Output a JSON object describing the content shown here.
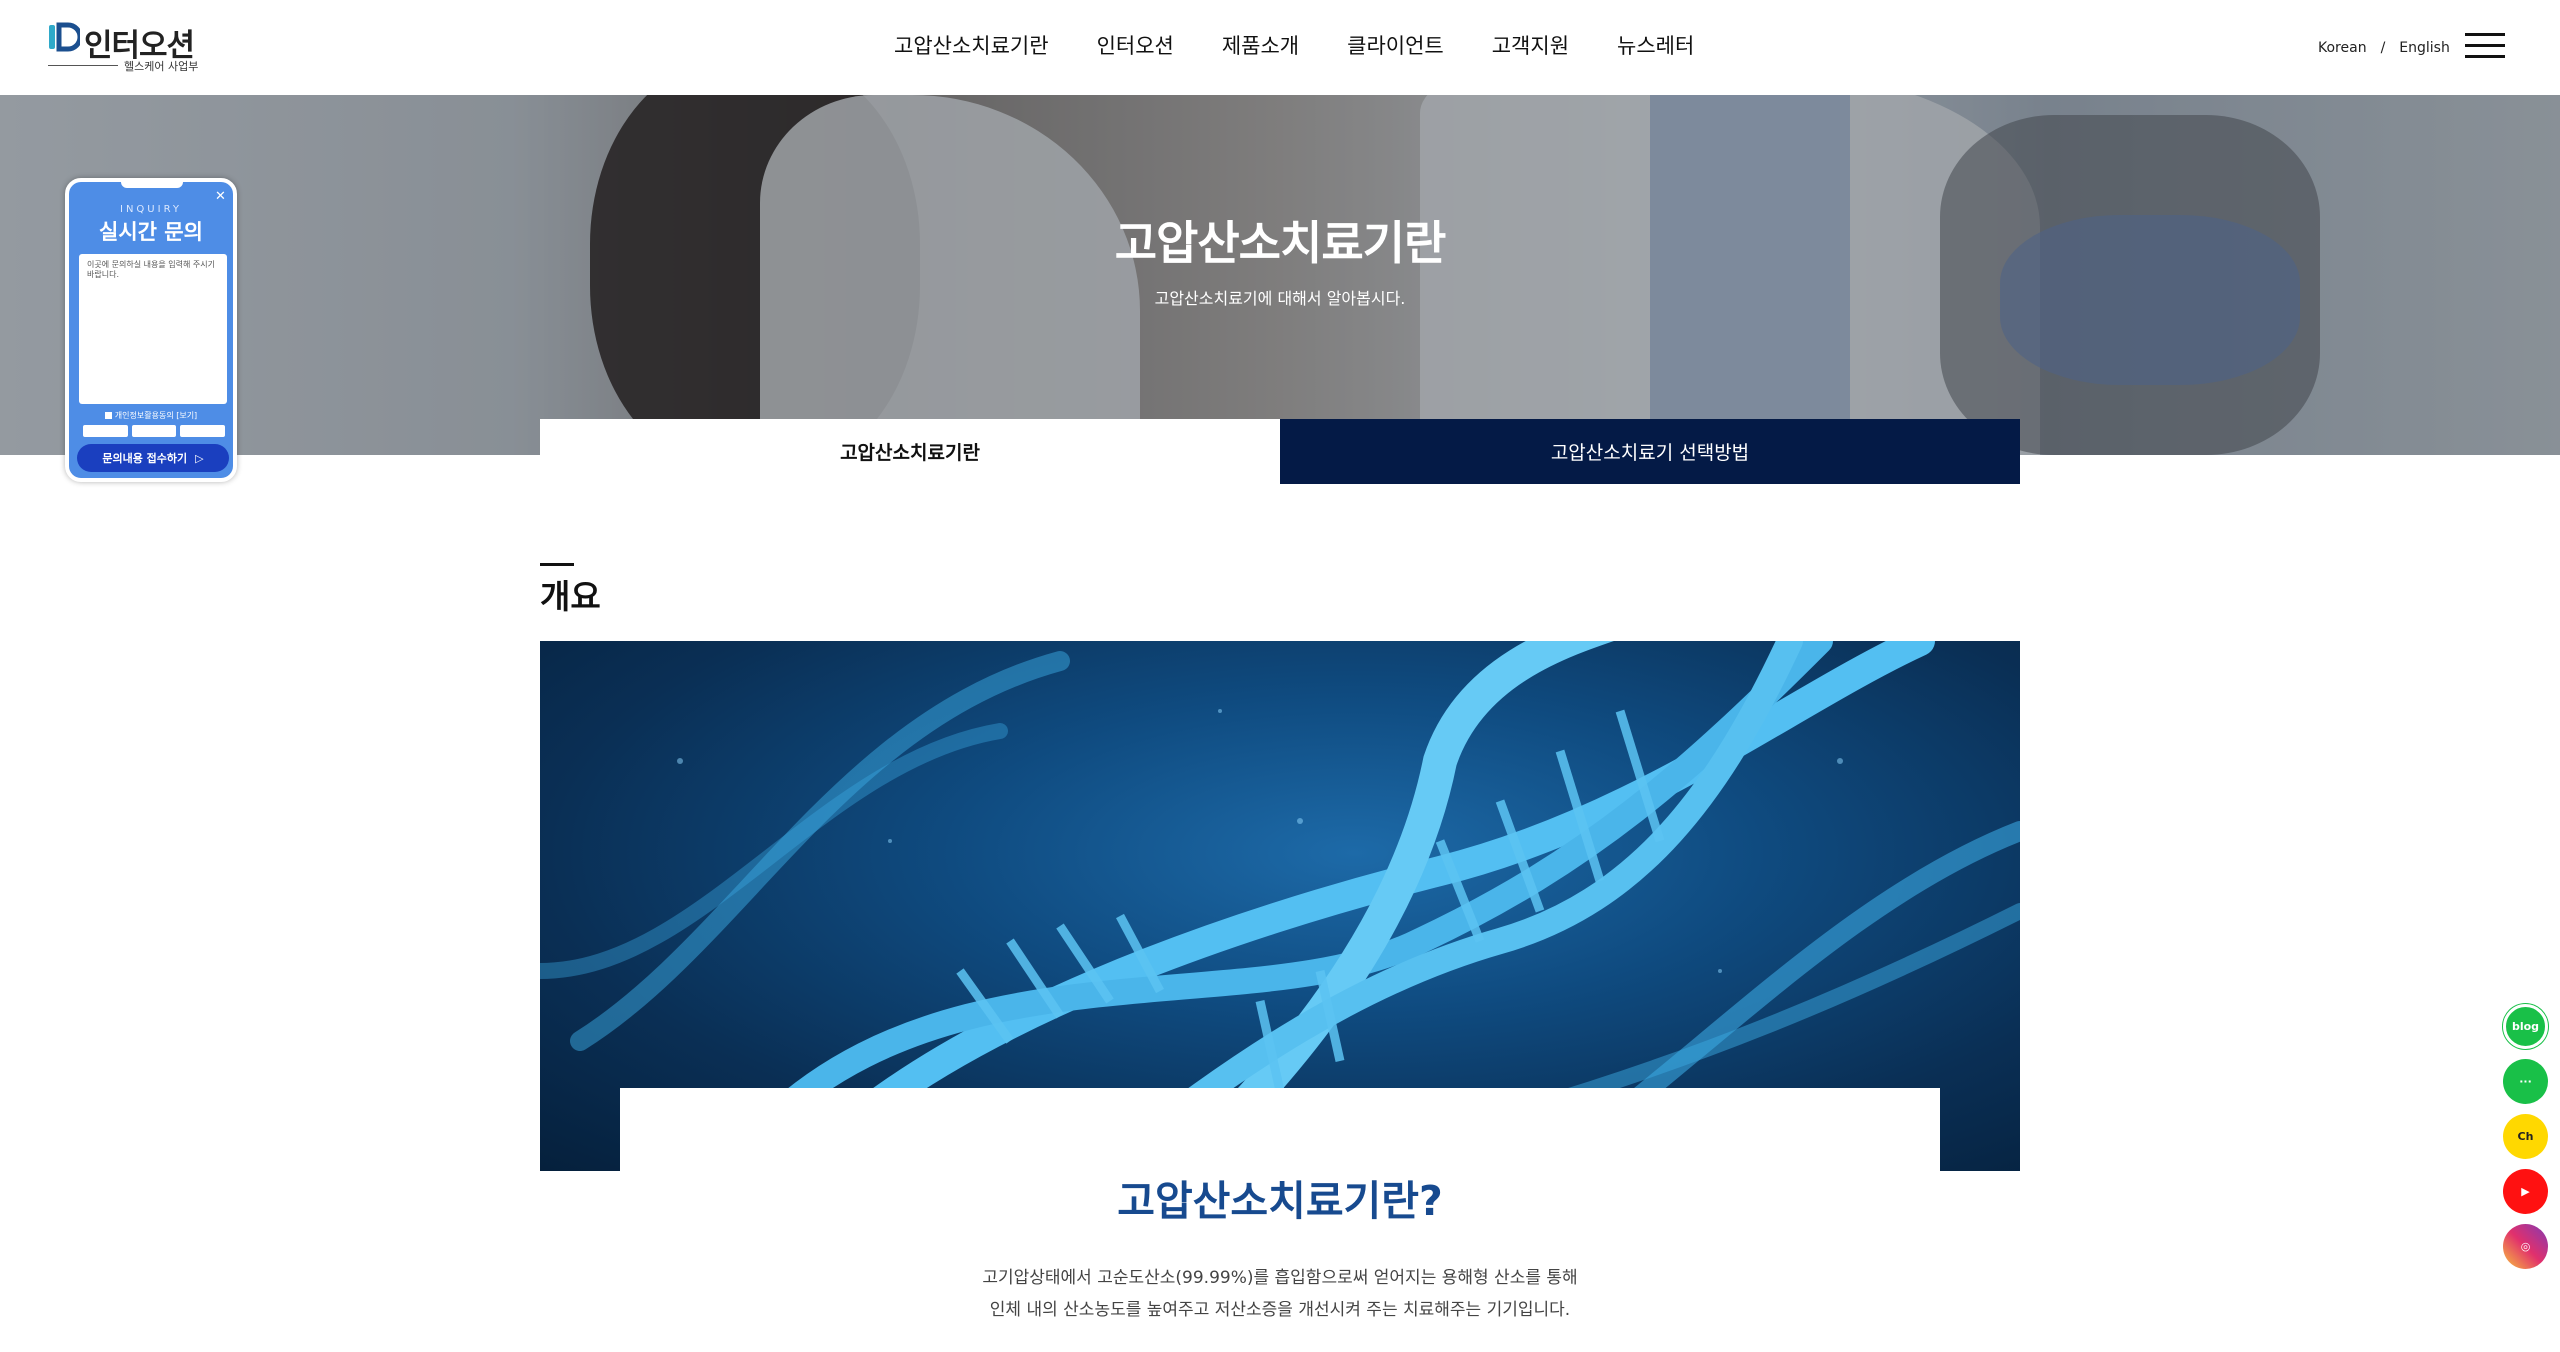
{
  "header": {
    "logo_text": "인터오션",
    "logo_sub": "헬스케어 사업부",
    "nav": [
      "고압산소치료기란",
      "인터오션",
      "제품소개",
      "클라이언트",
      "고객지원",
      "뉴스레터"
    ],
    "lang": {
      "korean": "Korean",
      "sep": "/",
      "english": "English"
    }
  },
  "hero": {
    "title": "고압산소치료기란",
    "subtitle": "고압산소치료기에 대해서 알아봅시다."
  },
  "tabs": [
    {
      "label": "고압산소치료기란",
      "active": true
    },
    {
      "label": "고압산소치료기 선택방법",
      "active": false
    }
  ],
  "inquiry": {
    "en": "INQUIRY",
    "title": "실시간 문의",
    "placeholder": "이곳에 문의하실 내용을 입력해 주시기 바랍니다.",
    "agree": "개인정보활용동의 [보기]",
    "button": "문의내용 접수하기",
    "close": "✕"
  },
  "section": {
    "title": "개요",
    "content_title": "고압산소치료기란?",
    "desc_line1": "고기압상태에서 고순도산소(99.99%)를 흡입함으로써 얻어지는 용해형 산소를 통해",
    "desc_line2": "인체 내의 산소농도를 높여주고 저산소증을 개선시켜 주는 치료해주는 기기입니다."
  },
  "sns": [
    {
      "name": "blog-icon",
      "label": "blog"
    },
    {
      "name": "talk-icon",
      "label": "···"
    },
    {
      "name": "channel-icon",
      "label": "Ch"
    },
    {
      "name": "youtube-icon",
      "label": "▶"
    },
    {
      "name": "instagram-icon",
      "label": "◎"
    }
  ],
  "colors": {
    "nav_dark": "#041a46",
    "title_blue": "#174a8f",
    "inquiry_blue": "#4e8de6",
    "sns_green": "#19c048",
    "sns_yellow": "#ffd800",
    "sns_red": "#ff1111"
  }
}
